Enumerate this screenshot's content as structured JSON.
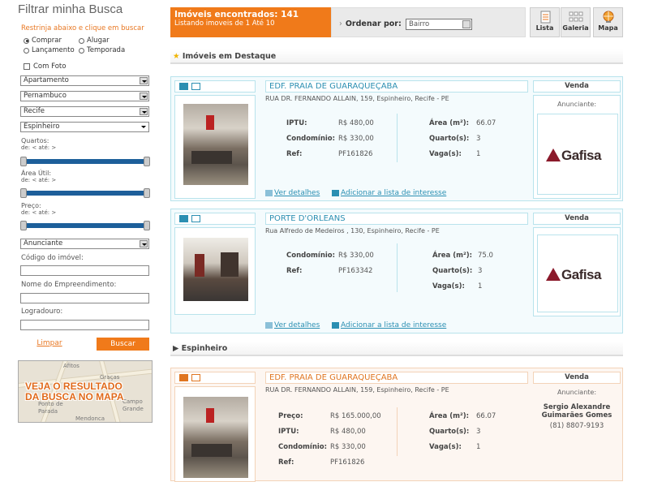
{
  "sidebar": {
    "title": "Filtrar minha Busca",
    "subtitle": "Restrinja abaixo e clique em buscar",
    "radios": [
      "Comprar",
      "Alugar",
      "Lançamento",
      "Temporada"
    ],
    "checkbox": "Com Foto",
    "selects": [
      "Apartamento",
      "Pernambuco",
      "Recife",
      "Espinheiro"
    ],
    "quartos_label": "Quartos:",
    "quartos_range": "de: < até: >",
    "area_label": "Área Útil:",
    "area_range": "de: < até: >",
    "preco_label": "Preço:",
    "preco_range": "de: < até: >",
    "anunciante_select": "Anunciante",
    "codigo_label": "Código do imóvel:",
    "empreendimento_label": "Nome do Empreendimento:",
    "logradouro_label": "Logradouro:",
    "limpar": "Limpar",
    "buscar": "Buscar",
    "map_banner_line1": "VEJA O RESULTADO",
    "map_banner_line2": "DA BUSCA NO MAPA",
    "map_places": [
      "Afitos",
      "Graças",
      "Ponto de",
      "Parada",
      "Campo",
      "Grande",
      "Mendonca"
    ]
  },
  "topbar": {
    "found": "Imóveis encontrados: 141",
    "listing": "Listando imoveis de 1 Até 10",
    "order_label": "Ordenar por:",
    "order_value": "Bairro",
    "views": [
      "Lista",
      "Galeria",
      "Mapa"
    ]
  },
  "sections": {
    "destaque": "Imóveis em Destaque",
    "espinheiro": "Espinheiro"
  },
  "cards": [
    {
      "name": "EDF. PRAIA DE GUARAQUEÇABA",
      "address": "RUA DR. FERNANDO ALLAIN, 159, Espinheiro, Recife - PE",
      "deal": "Venda",
      "anunciante_label": "Anunciante:",
      "logo": "Gafisa",
      "iptu_label": "IPTU:",
      "iptu": "R$ 480,00",
      "cond_label": "Condomínio:",
      "cond": "R$ 330,00",
      "ref_label": "Ref:",
      "ref": "PF161826",
      "area_label": "Área (m²):",
      "area": "66.07",
      "quartos_label": "Quarto(s):",
      "quartos": "3",
      "vagas_label": "Vaga(s):",
      "vagas": "1",
      "details": "Ver detalhes",
      "interest": "Adicionar a lista de interesse"
    },
    {
      "name": "PORTE D'ORLEANS",
      "address": "Rua Alfredo de Medeiros , 130, Espinheiro, Recife - PE",
      "deal": "Venda",
      "logo": "Gafisa",
      "cond_label": "Condomínio:",
      "cond": "R$ 330,00",
      "ref_label": "Ref:",
      "ref": "PF163342",
      "area_label": "Área (m²):",
      "area": "75.0",
      "quartos_label": "Quarto(s):",
      "quartos": "3",
      "vagas_label": "Vaga(s):",
      "vagas": "1",
      "details": "Ver detalhes",
      "interest": "Adicionar a lista de interesse"
    },
    {
      "name": "EDF. PRAIA DE GUARAQUEÇABA",
      "address": "RUA DR. FERNANDO ALLAIN, 159, Espinheiro, Recife - PE",
      "deal": "Venda",
      "anunciante_label": "Anunciante:",
      "advertiser": "Sergio Alexandre Guimarães Gomes",
      "phone": "(81) 8807-9193",
      "preco_label": "Preço:",
      "preco": "R$ 165.000,00",
      "iptu_label": "IPTU:",
      "iptu": "R$ 480,00",
      "cond_label": "Condomínio:",
      "cond": "R$ 330,00",
      "ref_label": "Ref:",
      "ref": "PF161826",
      "area_label": "Área (m²):",
      "area": "66.07",
      "quartos_label": "Quarto(s):",
      "quartos": "3",
      "vagas_label": "Vaga(s):",
      "vagas": "1"
    }
  ],
  "colors": {
    "accent": "#f07a1a",
    "blue_link": "#2b8fb2",
    "slider": "#1d5f9a",
    "gafisa": "#8b1a2b"
  }
}
